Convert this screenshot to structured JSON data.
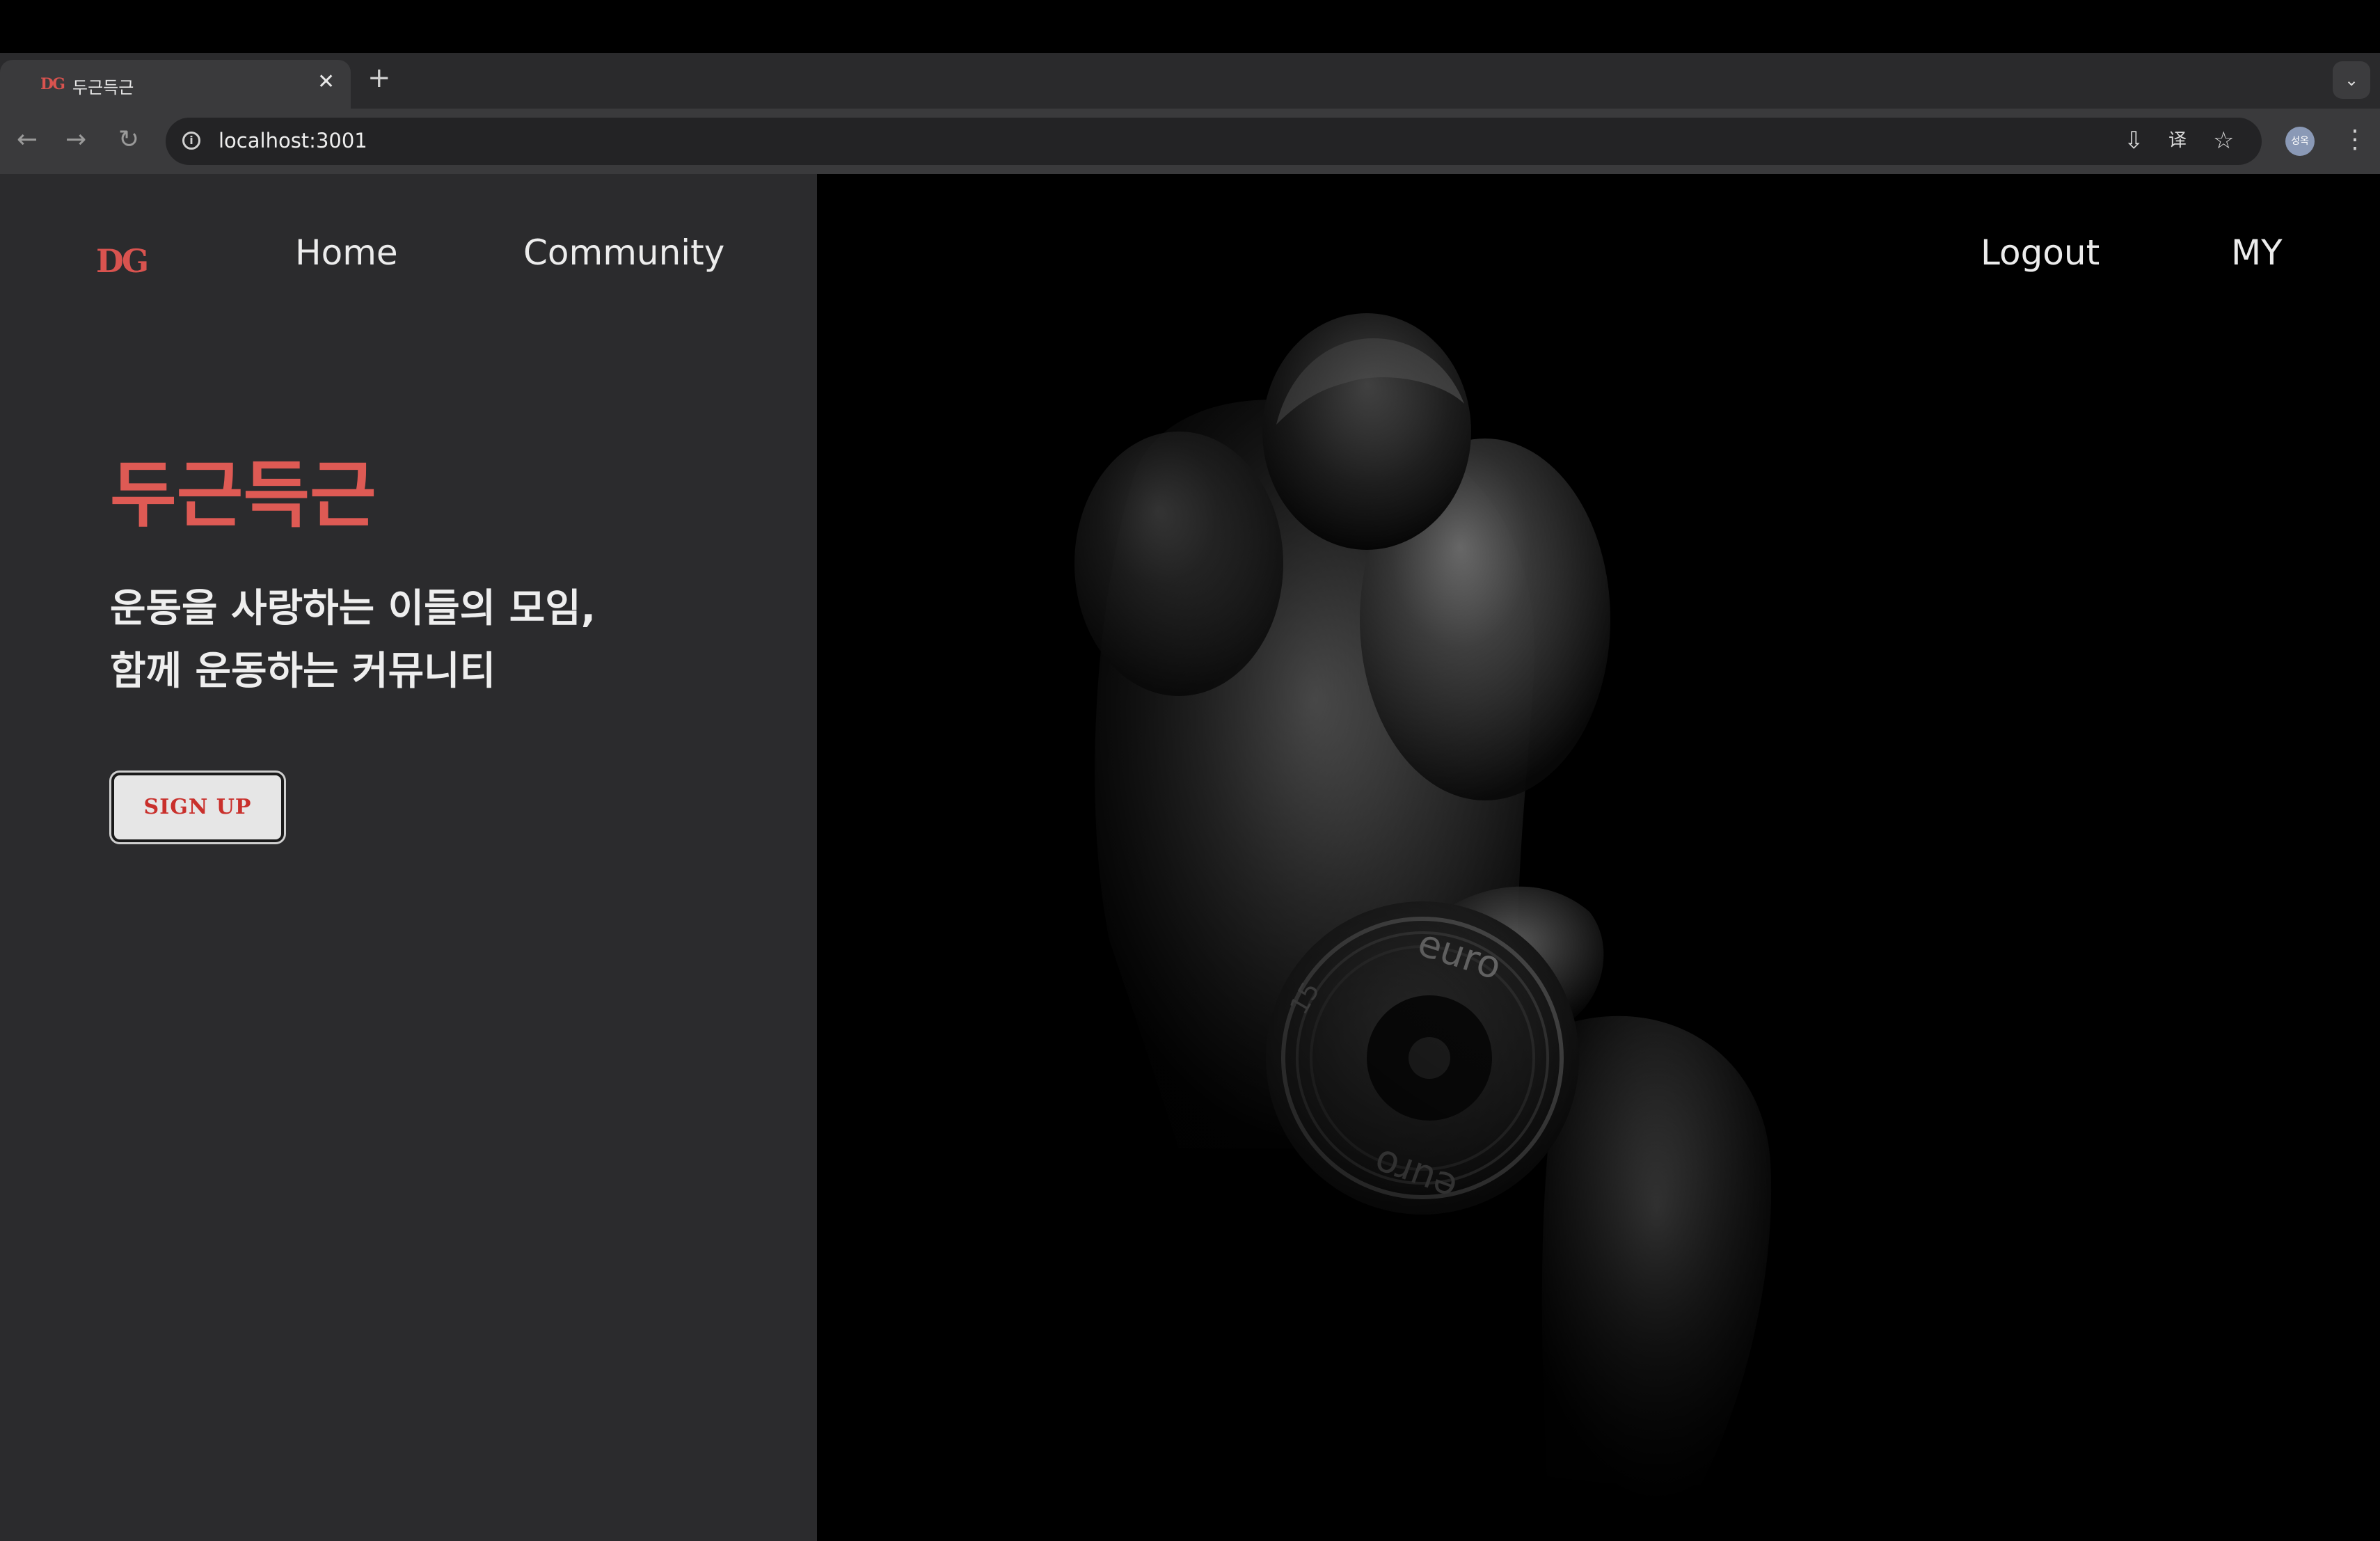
{
  "browser": {
    "tab": {
      "favicon_text": "DG",
      "title": "두근득근",
      "close_glyph": "✕"
    },
    "new_tab_glyph": "+",
    "tab_list_glyph": "⌄",
    "nav": {
      "back": "←",
      "forward": "→",
      "reload": "↻"
    },
    "url": "localhost:3001",
    "site_info_glyph": "i",
    "icons": {
      "install": "⇩",
      "translate": "译",
      "bookmark": "☆",
      "menu": "⋮"
    },
    "profile_text": "성옥"
  },
  "site": {
    "logo": "DG",
    "nav_left": [
      "Home",
      "Community"
    ],
    "nav_right": [
      "Logout",
      "MY"
    ],
    "title": "두근득근",
    "tagline_line1": "운동을 사랑하는 이들의 모임,",
    "tagline_line2": "함께 운동하는 커뮤니티",
    "signup_label": "SIGN UP",
    "hero_plate_text_top": "euro",
    "hero_plate_text_bottom": "euro",
    "hero_plate_weight": "15"
  },
  "colors": {
    "accent": "#d9534f",
    "panel_bg": "#2b2b2d",
    "hero_bg": "#000000",
    "text_light": "#ececec"
  }
}
